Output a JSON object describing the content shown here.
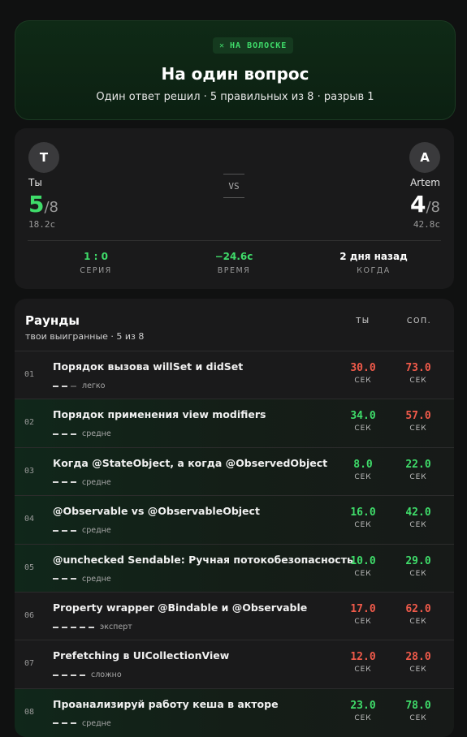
{
  "hero": {
    "badge": "НА ВОЛОСКЕ",
    "title": "На один вопрос",
    "subtitle": "Один ответ решил · 5 правильных из 8 · разрыв 1"
  },
  "duel": {
    "you": {
      "initial": "Т",
      "name": "Ты",
      "score": "5",
      "total": "/8",
      "time": "18.2с"
    },
    "opponent": {
      "initial": "A",
      "name": "Artem",
      "score": "4",
      "total": "/8",
      "time": "42.8с"
    },
    "vs": "VS",
    "stats": [
      {
        "value": "1 : 0",
        "label": "СЕРИЯ"
      },
      {
        "value": "−24.6с",
        "label": "ВРЕМЯ"
      },
      {
        "value": "2 дня назад",
        "label": "КОГДА"
      }
    ]
  },
  "rounds": {
    "title": "Раунды",
    "subtitle": "твои выигранные · 5 из 8",
    "col_you": "ТЫ",
    "col_opp": "СОП.",
    "unit": "СЕК",
    "items": [
      {
        "num": "01",
        "question": "Порядок вызова willSet и didSet",
        "difficulty": "легко",
        "level": 2,
        "max": 3,
        "you": "30.0",
        "opp": "73.0",
        "won": false,
        "you_color": "red",
        "opp_color": "red"
      },
      {
        "num": "02",
        "question": "Порядок применения view modifiers",
        "difficulty": "средне",
        "level": 3,
        "max": 3,
        "you": "34.0",
        "opp": "57.0",
        "won": true,
        "you_color": "green",
        "opp_color": "red"
      },
      {
        "num": "03",
        "question": "Когда @StateObject, а когда @ObservedObject",
        "difficulty": "средне",
        "level": 3,
        "max": 3,
        "you": "8.0",
        "opp": "22.0",
        "won": true,
        "you_color": "green",
        "opp_color": "green"
      },
      {
        "num": "04",
        "question": "@Observable vs @ObservableObject",
        "difficulty": "средне",
        "level": 3,
        "max": 3,
        "you": "16.0",
        "opp": "42.0",
        "won": true,
        "you_color": "green",
        "opp_color": "green"
      },
      {
        "num": "05",
        "question": "@unchecked Sendable: Ручная потокобезопасность",
        "difficulty": "средне",
        "level": 3,
        "max": 3,
        "you": "10.0",
        "opp": "29.0",
        "won": true,
        "you_color": "green",
        "opp_color": "green"
      },
      {
        "num": "06",
        "question": "Property wrapper @Bindable и @Observable",
        "difficulty": "эксперт",
        "level": 5,
        "max": 5,
        "you": "17.0",
        "opp": "62.0",
        "won": false,
        "you_color": "red",
        "opp_color": "red"
      },
      {
        "num": "07",
        "question": "Prefetching в UICollectionView",
        "difficulty": "сложно",
        "level": 4,
        "max": 4,
        "you": "12.0",
        "opp": "28.0",
        "won": false,
        "you_color": "red",
        "opp_color": "red"
      },
      {
        "num": "08",
        "question": "Проанализируй работу кеша в акторе",
        "difficulty": "средне",
        "level": 3,
        "max": 3,
        "you": "23.0",
        "opp": "78.0",
        "won": true,
        "you_color": "green",
        "opp_color": "green"
      }
    ]
  },
  "colors": {
    "accent_green": "#3fdc6a",
    "loss_red": "#f05a4a",
    "card_bg": "#1a1a1b",
    "hero_bg": "#0f2a16"
  }
}
